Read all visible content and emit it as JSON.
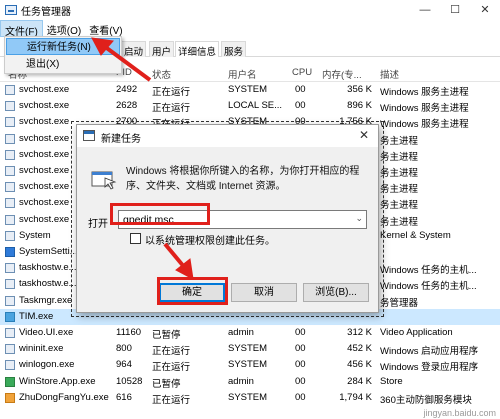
{
  "window": {
    "title": "任务管理器",
    "controls": [
      "—",
      "☐",
      "✕"
    ]
  },
  "menubar": {
    "items": [
      "文件(F)",
      "选项(O)",
      "查看(V)"
    ]
  },
  "file_menu": {
    "items": [
      "运行新任务(N)",
      "退出(X)"
    ]
  },
  "tabs": [
    "启动",
    "用户",
    "详细信息",
    "服务"
  ],
  "columns": [
    "名称",
    "PID",
    "状态",
    "用户名",
    "CPU",
    "内存(专...",
    "描述"
  ],
  "rows": [
    {
      "name": "svchost.exe",
      "pid": "2492",
      "status": "正在运行",
      "user": "SYSTEM",
      "cpu": "00",
      "mem": "356 K",
      "desc": "Windows 服务主进程",
      "icon": "svc"
    },
    {
      "name": "svchost.exe",
      "pid": "2628",
      "status": "正在运行",
      "user": "LOCAL SE...",
      "cpu": "00",
      "mem": "896 K",
      "desc": "Windows 服务主进程",
      "icon": "svc"
    },
    {
      "name": "svchost.exe",
      "pid": "2700",
      "status": "正在运行",
      "user": "SYSTEM",
      "cpu": "00",
      "mem": "1,756 K",
      "desc": "Windows 服务主进程",
      "icon": "svc"
    },
    {
      "name": "svchost.exe",
      "pid": "",
      "status": "",
      "user": "",
      "cpu": "",
      "mem": "",
      "desc": "务主进程",
      "icon": "svc"
    },
    {
      "name": "svchost.exe",
      "pid": "",
      "status": "",
      "user": "",
      "cpu": "",
      "mem": "",
      "desc": "务主进程",
      "icon": "svc"
    },
    {
      "name": "svchost.exe",
      "pid": "",
      "status": "",
      "user": "",
      "cpu": "",
      "mem": "",
      "desc": "务主进程",
      "icon": "svc"
    },
    {
      "name": "svchost.exe",
      "pid": "",
      "status": "",
      "user": "",
      "cpu": "",
      "mem": "",
      "desc": "务主进程",
      "icon": "svc"
    },
    {
      "name": "svchost.exe",
      "pid": "",
      "status": "",
      "user": "",
      "cpu": "",
      "mem": "",
      "desc": "务主进程",
      "icon": "svc"
    },
    {
      "name": "svchost.exe",
      "pid": "",
      "status": "",
      "user": "",
      "cpu": "",
      "mem": "",
      "desc": "务主进程",
      "icon": "svc"
    },
    {
      "name": "System",
      "pid": "",
      "status": "",
      "user": "",
      "cpu": "",
      "mem": "",
      "desc": "Kernel & System",
      "icon": "svc"
    },
    {
      "name": "SystemSetti...",
      "pid": "",
      "status": "",
      "user": "",
      "cpu": "",
      "mem": "",
      "desc": "",
      "icon": "blue"
    },
    {
      "name": "taskhostw.e...",
      "pid": "",
      "status": "",
      "user": "",
      "cpu": "",
      "mem": "",
      "desc": "Windows 任务的主机...",
      "icon": "svc"
    },
    {
      "name": "taskhostw.e...",
      "pid": "",
      "status": "",
      "user": "",
      "cpu": "",
      "mem": "",
      "desc": "Windows 任务的主机...",
      "icon": "svc"
    },
    {
      "name": "Taskmgr.exe",
      "pid": "",
      "status": "",
      "user": "",
      "cpu": "",
      "mem": "",
      "desc": "务管理器",
      "icon": "svc"
    },
    {
      "name": "TIM.exe",
      "pid": "",
      "status": "",
      "user": "",
      "cpu": "",
      "mem": "",
      "desc": "",
      "icon": "tim"
    },
    {
      "name": "Video.UI.exe",
      "pid": "11160",
      "status": "已暂停",
      "user": "admin",
      "cpu": "00",
      "mem": "312 K",
      "desc": "Video Application",
      "icon": "svc"
    },
    {
      "name": "wininit.exe",
      "pid": "800",
      "status": "正在运行",
      "user": "SYSTEM",
      "cpu": "00",
      "mem": "452 K",
      "desc": "Windows 启动应用程序",
      "icon": "svc"
    },
    {
      "name": "winlogon.exe",
      "pid": "964",
      "status": "正在运行",
      "user": "SYSTEM",
      "cpu": "00",
      "mem": "456 K",
      "desc": "Windows 登录应用程序",
      "icon": "svc"
    },
    {
      "name": "WinStore.App.exe",
      "pid": "10528",
      "status": "已暂停",
      "user": "admin",
      "cpu": "00",
      "mem": "284 K",
      "desc": "Store",
      "icon": "grn"
    },
    {
      "name": "ZhuDongFangYu.exe",
      "pid": "616",
      "status": "正在运行",
      "user": "SYSTEM",
      "cpu": "00",
      "mem": "1,794 K",
      "desc": "360主动防御服务模块",
      "icon": "ora"
    }
  ],
  "dialog": {
    "title": "新建任务",
    "close": "✕",
    "description": "Windows 将根据你所键入的名称，为你打开相应的程序、文件夹、文档或 Internet 资源。",
    "open_label": "打开",
    "input_value": "gpedit.msc",
    "checkbox_label": "以系统管理权限创建此任务。",
    "buttons": {
      "ok": "确定",
      "cancel": "取消",
      "browse": "浏览(B)..."
    }
  },
  "watermark": "jingyan.baidu.com",
  "annotation_color": "#e0201b"
}
